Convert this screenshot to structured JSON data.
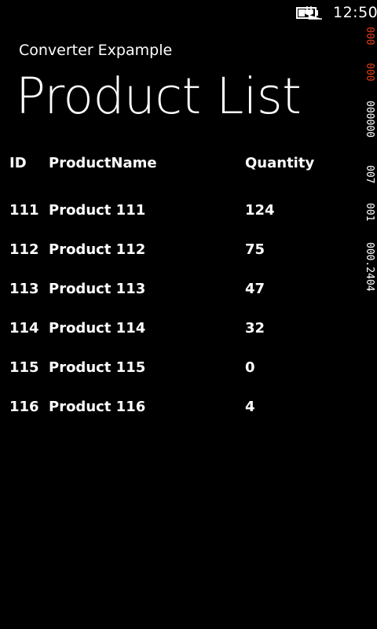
{
  "status": {
    "time": "12:50",
    "battery_icon": "battery-charging-icon"
  },
  "app": {
    "subtitle": "Converter Expample",
    "title": "Product List"
  },
  "table": {
    "headers": {
      "id": "ID",
      "name": "ProductName",
      "quantity": "Quantity"
    },
    "rows": [
      {
        "id": "111",
        "name": "Product 111",
        "quantity": "124"
      },
      {
        "id": "112",
        "name": "Product 112",
        "quantity": "75"
      },
      {
        "id": "113",
        "name": "Product 113",
        "quantity": "47"
      },
      {
        "id": "114",
        "name": "Product 114",
        "quantity": "32"
      },
      {
        "id": "115",
        "name": "Product 115",
        "quantity": "0"
      },
      {
        "id": "116",
        "name": "Product 116",
        "quantity": "4"
      }
    ]
  },
  "debug": {
    "counters": [
      "000",
      "000",
      "000000",
      "007",
      "001",
      "000.2404"
    ],
    "accent_color": "#e0401a",
    "text_color": "#ffffff"
  }
}
